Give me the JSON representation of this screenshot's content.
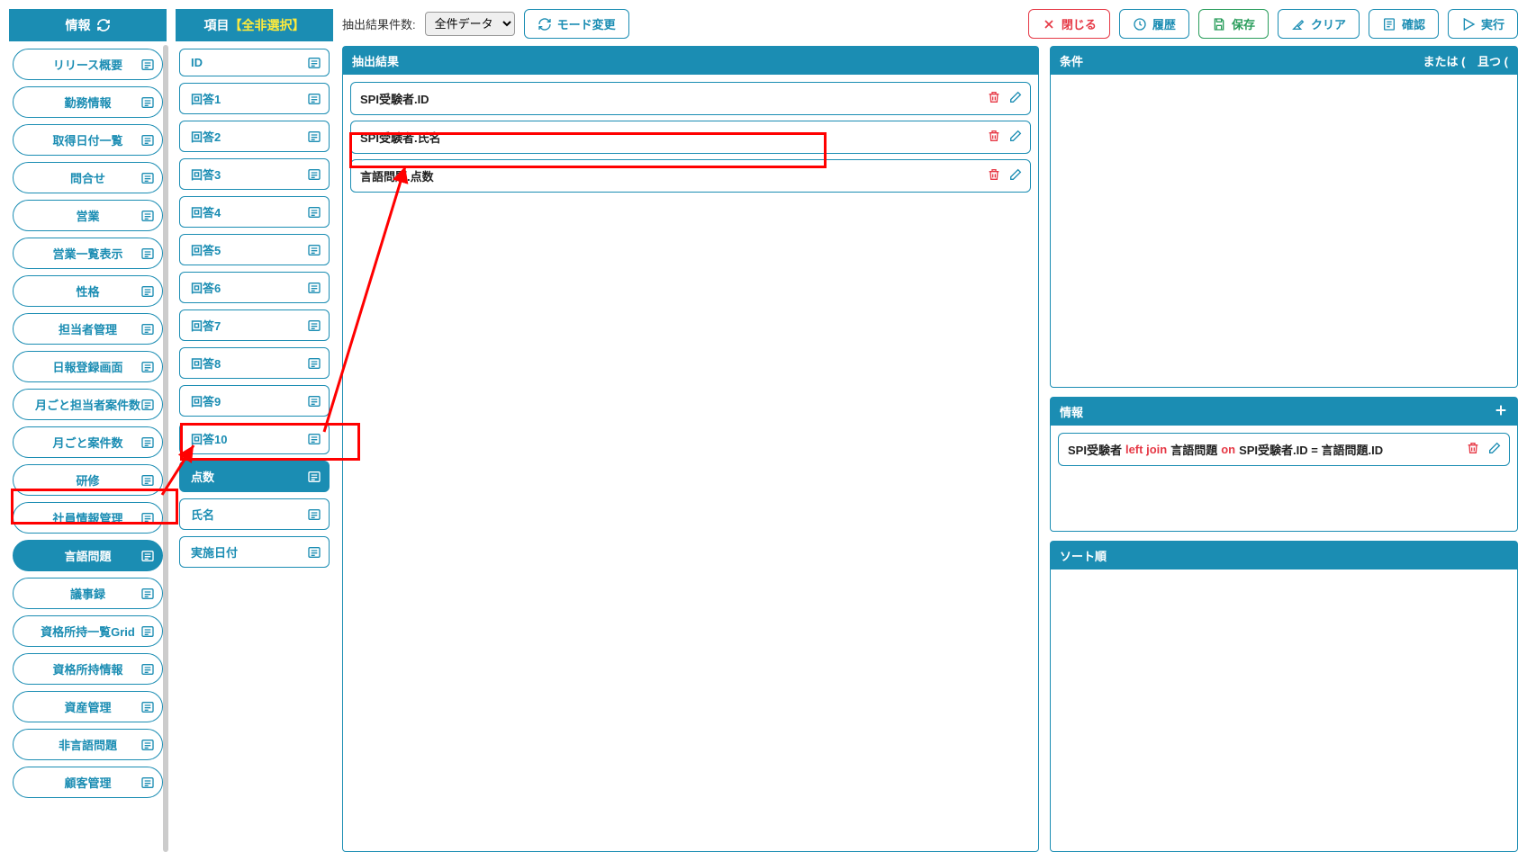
{
  "info_panel": {
    "title": "情報"
  },
  "info_items": [
    "リリース概要",
    "勤務情報",
    "取得日付一覧",
    "問合せ",
    "営業",
    "営業一覧表示",
    "性格",
    "担当者管理",
    "日報登録画面",
    "月ごと担当者案件数",
    "月ごと案件数",
    "研修",
    "社員情報管理",
    "言語問題",
    "議事録",
    "資格所持一覧Grid",
    "資格所持情報",
    "資産管理",
    "非言語問題",
    "顧客管理"
  ],
  "col_panel": {
    "title": "項目",
    "toggle": "【全非選択】"
  },
  "col_items": [
    {
      "label": "ID"
    },
    {
      "label": "回答1"
    },
    {
      "label": "回答2"
    },
    {
      "label": "回答3"
    },
    {
      "label": "回答4"
    },
    {
      "label": "回答5"
    },
    {
      "label": "回答6"
    },
    {
      "label": "回答7"
    },
    {
      "label": "回答8"
    },
    {
      "label": "回答9"
    },
    {
      "label": "回答10"
    },
    {
      "label": "点数",
      "selected": true
    },
    {
      "label": "氏名"
    },
    {
      "label": "実施日付"
    }
  ],
  "toolbar": {
    "count_label": "抽出結果件数:",
    "select_value": "全件データ",
    "mode_btn": "モード変更",
    "close_btn": "閉じる",
    "history_btn": "履歴",
    "save_btn": "保存",
    "clear_btn": "クリア",
    "confirm_btn": "確認",
    "run_btn": "実行"
  },
  "result": {
    "header": "抽出結果",
    "rows": [
      "SPI受験者.ID",
      "SPI受験者.氏名",
      "言語問題.点数"
    ]
  },
  "condition": {
    "header": "条件",
    "or": "または (",
    "and": "且つ ("
  },
  "info_section": {
    "header": "情報",
    "row": {
      "a": "SPI受験者",
      "lj": "left join",
      "b": "言語問題",
      "on": "on",
      "c": "SPI受験者.ID = 言語問題.ID"
    }
  },
  "sort": {
    "header": "ソート順"
  }
}
